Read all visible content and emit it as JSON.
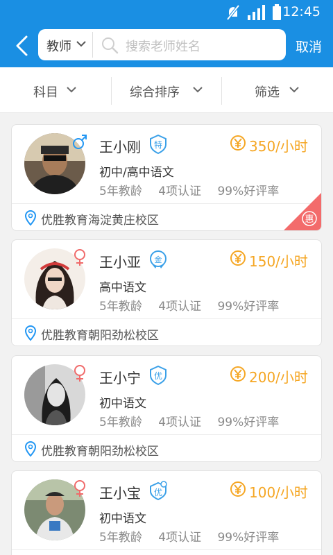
{
  "status_bar": {
    "time": "12:45",
    "icons": [
      "mute-icon",
      "signal-icon",
      "battery-icon"
    ]
  },
  "header": {
    "back_icon": "back-arrow-icon",
    "search_type": "教师",
    "search_placeholder": "搜索老师姓名",
    "cancel_label": "取消"
  },
  "filters": [
    {
      "label": "科目"
    },
    {
      "label": "综合排序"
    },
    {
      "label": "筛选"
    }
  ],
  "colors": {
    "primary": "#1a8fe3",
    "price": "#f5a623",
    "male": "#2196f3",
    "female": "#f06a6a",
    "badge": "#3aa0e8",
    "promo": "#f36b6b"
  },
  "teachers": [
    {
      "name": "王小刚",
      "gender": "male",
      "badge": "特",
      "price": "350/小时",
      "subject": "初中/高中语文",
      "years": "5年教龄",
      "certs": "4项认证",
      "rating": "99%好评率",
      "campus": "优胜教育海淀黄庄校区",
      "promo": "惠"
    },
    {
      "name": "王小亚",
      "gender": "female",
      "badge": "金",
      "price": "150/小时",
      "subject": "高中语文",
      "years": "5年教龄",
      "certs": "4项认证",
      "rating": "99%好评率",
      "campus": "优胜教育朝阳劲松校区"
    },
    {
      "name": "王小宁",
      "gender": "female",
      "badge": "优",
      "price": "200/小时",
      "subject": "初中语文",
      "years": "5年教龄",
      "certs": "4项认证",
      "rating": "99%好评率",
      "campus": "优胜教育朝阳劲松校区"
    },
    {
      "name": "王小宝",
      "gender": "female",
      "badge": "优",
      "price": "100/小时",
      "subject": "初中语文",
      "years": "5年教龄",
      "certs": "4项认证",
      "rating": "99%好评率",
      "campus": ""
    }
  ]
}
